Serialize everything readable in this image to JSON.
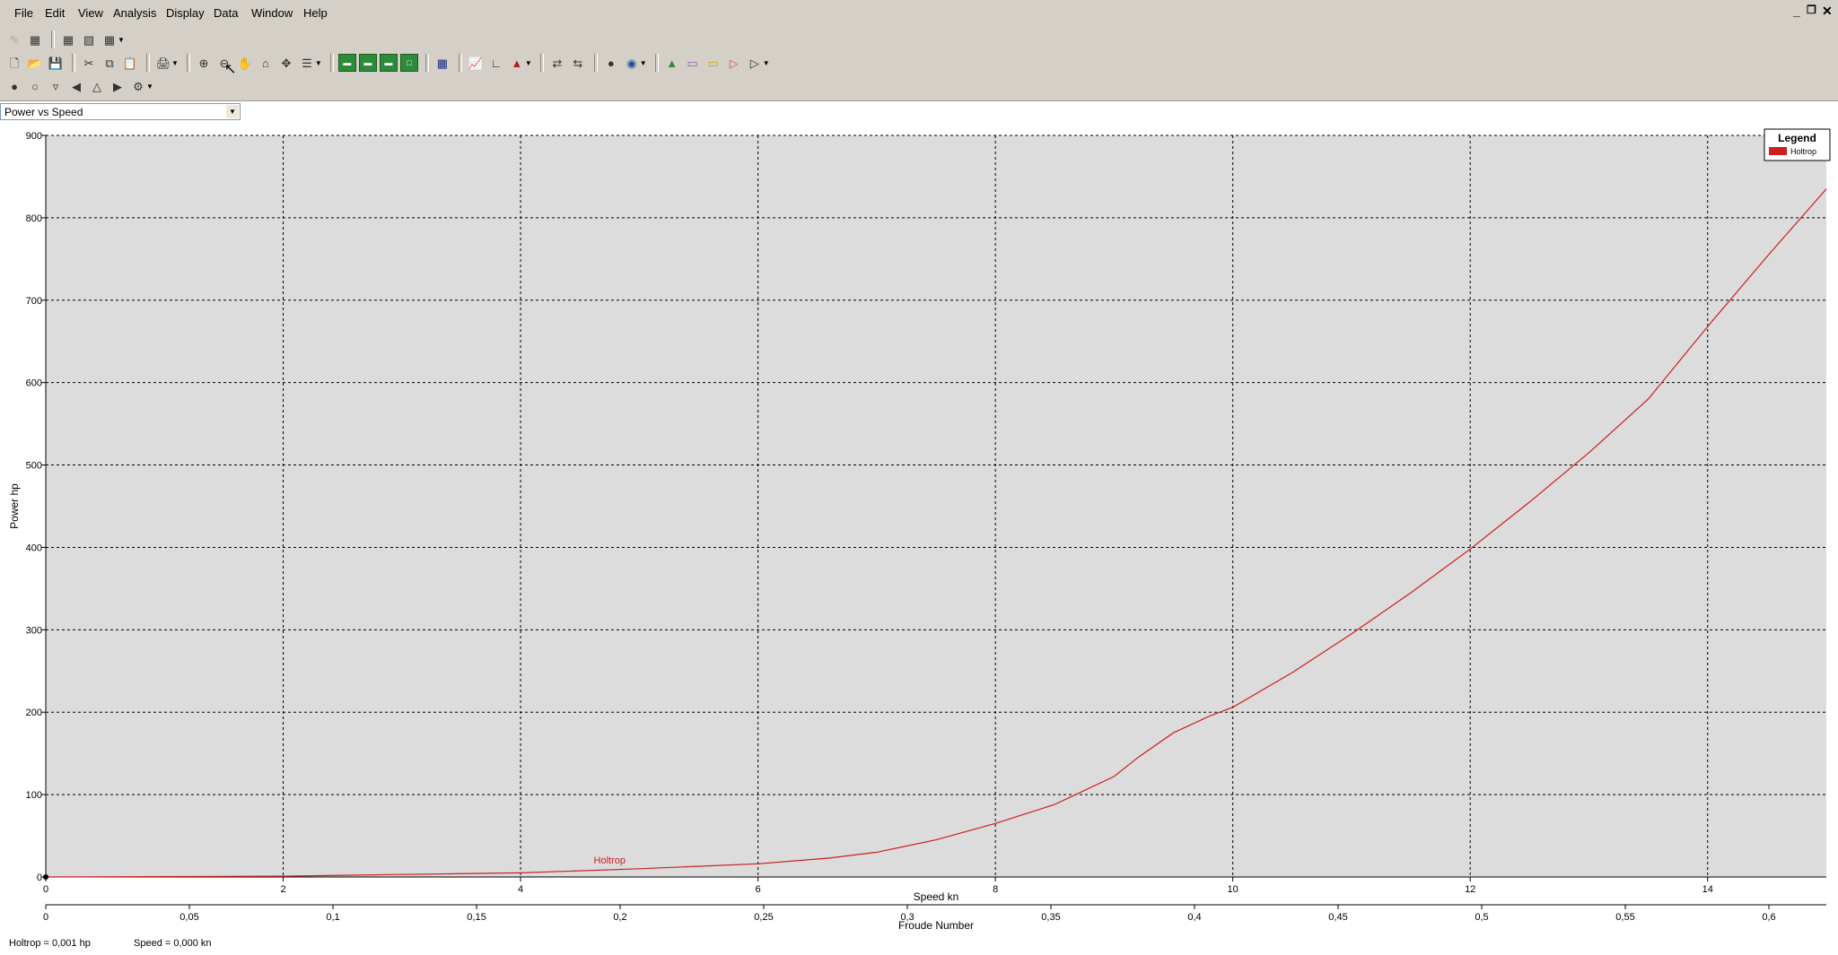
{
  "menubar": {
    "items": [
      "File",
      "Edit",
      "View",
      "Analysis",
      "Display",
      "Data",
      "Window",
      "Help"
    ],
    "window_controls": [
      "_",
      "❐",
      "✕"
    ]
  },
  "toolbar": {
    "icons": [
      "new-icon",
      "open-icon",
      "save-icon",
      "cut-icon",
      "copy-icon",
      "paste-icon",
      "print-icon",
      "zoom-in-icon",
      "zoom-out-icon",
      "pan-icon",
      "home-icon",
      "fit-icon",
      "tree-icon",
      "grid-green-icon",
      "grid-green-icon",
      "grid-green-icon",
      "grid-green-icon",
      "table-icon",
      "chart-icon",
      "axes-icon",
      "area-chart-icon",
      "data-icon",
      "data2-icon",
      "circle-icon",
      "globe-icon",
      "shape-icon",
      "shape-icon",
      "shape-icon",
      "shape-icon",
      "shape-icon"
    ]
  },
  "plot_selector": {
    "value": "Power vs Speed"
  },
  "status": {
    "holtrop_label": "Holtrop  =  0,001 hp",
    "speed_label": "Speed  =  0,000 kn"
  },
  "colors": {
    "series": "#cc1f1f",
    "plot_bg": "#dcdcdc",
    "chrome": "#d4d0c8"
  },
  "chart_data": {
    "type": "line",
    "ylabel": "Power  hp",
    "xlabel": "Speed  kn",
    "x2label": "Froude Number",
    "xlim": [
      0,
      15
    ],
    "ylim": [
      0,
      900
    ],
    "xticks": [
      "0",
      "2",
      "4",
      "6",
      "8",
      "10",
      "12",
      "14"
    ],
    "yticks": [
      "0",
      "100",
      "200",
      "300",
      "400",
      "500",
      "600",
      "700",
      "800",
      "900"
    ],
    "x2ticks": [
      "0",
      "0,05",
      "0,1",
      "0,15",
      "0,2",
      "0,25",
      "0,3",
      "0,35",
      "0,4",
      "0,45",
      "0,5",
      "0,55",
      "0,6"
    ],
    "x2lim": [
      0,
      0.62
    ],
    "grid": true,
    "legend": {
      "title": "Legend",
      "entries": [
        "Holtrop"
      ],
      "placement": "top-right"
    },
    "series_label_text": "Holtrop",
    "series": [
      {
        "name": "Holtrop",
        "x": [
          0,
          2,
          3,
          4,
          5,
          6,
          6.6,
          7,
          7.5,
          8,
          8.5,
          9,
          9.2,
          9.5,
          9.8,
          10,
          10.5,
          11,
          11.5,
          12,
          12.5,
          13,
          13.5,
          14,
          14.5,
          15
        ],
        "y": [
          0,
          1,
          3,
          5,
          10,
          16,
          23,
          30,
          45,
          65,
          88,
          122,
          145,
          175,
          195,
          206,
          248,
          295,
          345,
          398,
          455,
          515,
          580,
          668,
          753,
          835
        ]
      }
    ]
  }
}
